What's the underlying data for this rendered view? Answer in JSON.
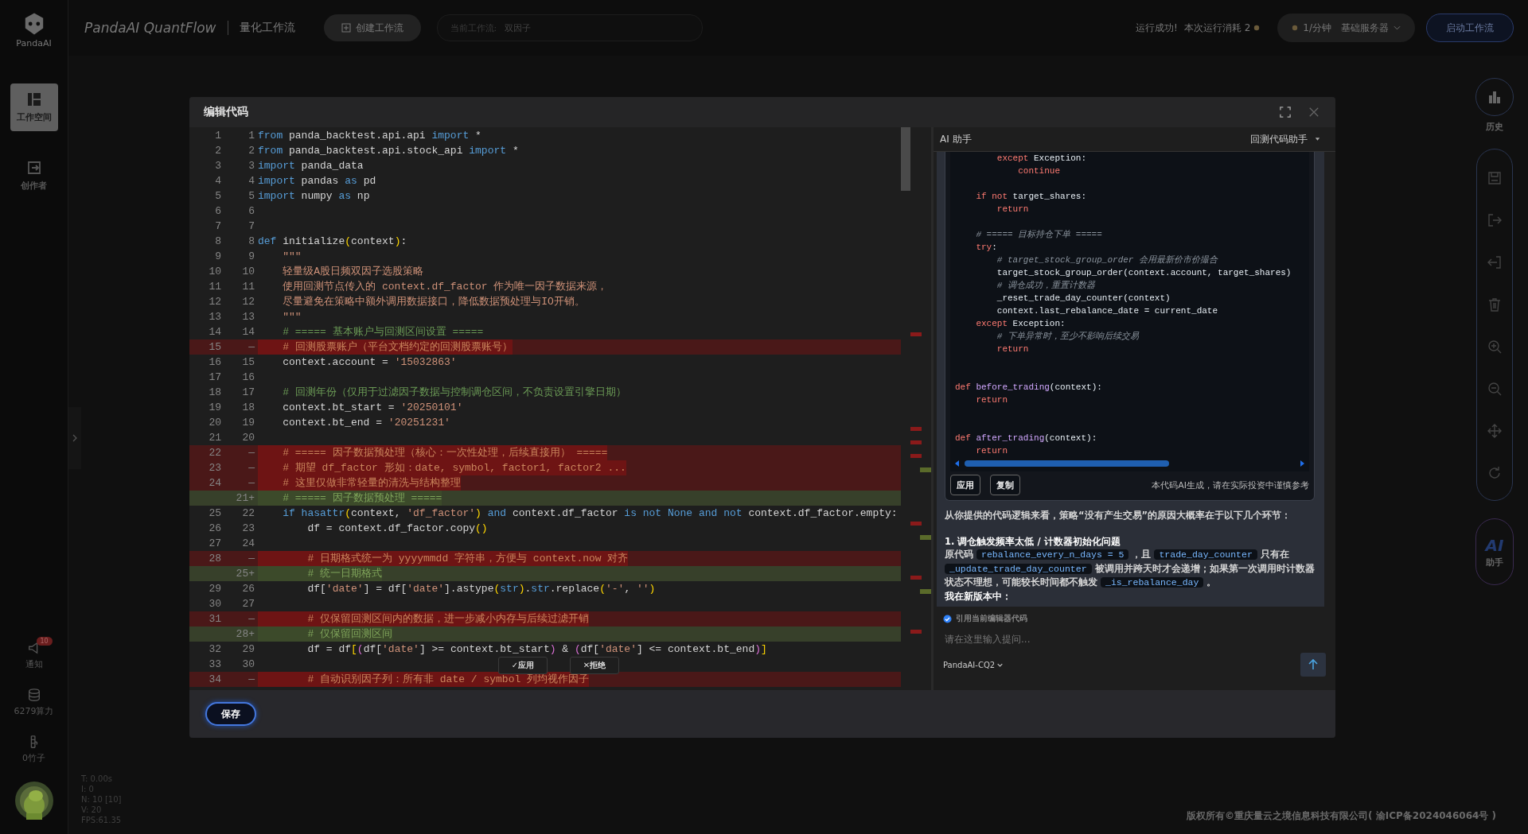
{
  "top_bar": {
    "logo_label": "PandaAI",
    "title": "PandaAI QuantFlow",
    "subtitle": "量化工作流",
    "create_button": "创建工作流",
    "workflow_field": {
      "label": "当前工作流:",
      "value": "双因子"
    },
    "run_status": "运行成功!",
    "run_cost": "本次运行消耗 2",
    "rate": "1/分钟",
    "server": "基础服务器",
    "start_button": "启动工作流"
  },
  "sidebar": {
    "items": [
      {
        "kind": "workspace",
        "label": "工作空间",
        "selected": true
      },
      {
        "kind": "creator",
        "label": "创作者",
        "selected": false
      }
    ],
    "bottom": [
      {
        "kind": "notice",
        "label": "通知",
        "badge": "10"
      },
      {
        "kind": "compute",
        "label": "6279算力"
      },
      {
        "kind": "bamboo",
        "label": "0竹子"
      }
    ]
  },
  "debug_stats": [
    "T: 0.00s",
    "I: 0",
    "N: 10 [10]",
    "V: 20",
    "FPS:61.35"
  ],
  "editor_dialog": {
    "title": "编辑代码",
    "lines": [
      {
        "old": "1",
        "new": "1",
        "kind": "context",
        "code": [
          {
            "kind": "keyword",
            "text": "from"
          },
          {
            "kind": "plain",
            "text": " panda_backtest.api.api "
          },
          {
            "kind": "keyword",
            "text": "import"
          },
          {
            "kind": "plain",
            "text": " *"
          }
        ]
      },
      {
        "old": "2",
        "new": "2",
        "kind": "context",
        "code": [
          {
            "kind": "keyword",
            "text": "from"
          },
          {
            "kind": "plain",
            "text": " panda_backtest.api.stock_api "
          },
          {
            "kind": "keyword",
            "text": "import"
          },
          {
            "kind": "plain",
            "text": " *"
          }
        ]
      },
      {
        "old": "3",
        "new": "3",
        "kind": "context",
        "code": [
          {
            "kind": "keyword",
            "text": "import"
          },
          {
            "kind": "plain",
            "text": " panda_data"
          }
        ]
      },
      {
        "old": "4",
        "new": "4",
        "kind": "context",
        "code": [
          {
            "kind": "keyword",
            "text": "import"
          },
          {
            "kind": "plain",
            "text": " pandas "
          },
          {
            "kind": "keyword",
            "text": "as"
          },
          {
            "kind": "plain",
            "text": " pd"
          }
        ]
      },
      {
        "old": "5",
        "new": "5",
        "kind": "context",
        "code": [
          {
            "kind": "keyword",
            "text": "import"
          },
          {
            "kind": "plain",
            "text": " numpy "
          },
          {
            "kind": "keyword",
            "text": "as"
          },
          {
            "kind": "plain",
            "text": " np"
          }
        ]
      },
      {
        "old": "6",
        "new": "6",
        "kind": "context"
      },
      {
        "old": "7",
        "new": "7",
        "kind": "context"
      },
      {
        "old": "8",
        "new": "8",
        "kind": "context",
        "code": [
          {
            "kind": "keyword",
            "text": "def"
          },
          {
            "kind": "plain",
            "text": " initialize"
          },
          {
            "kind": "bracket",
            "text": "("
          },
          {
            "kind": "plain",
            "text": "context"
          },
          {
            "kind": "bracket",
            "text": ")"
          },
          {
            "kind": "plain",
            "text": ":"
          }
        ]
      },
      {
        "old": "9",
        "new": "9",
        "kind": "context",
        "code": [
          {
            "kind": "doc",
            "text": "    \"\"\""
          }
        ]
      },
      {
        "old": "10",
        "new": "10",
        "kind": "context",
        "code": [
          {
            "kind": "doc",
            "text": "    轻量级A股日频双因子选股策略"
          }
        ]
      },
      {
        "old": "11",
        "new": "11",
        "kind": "context",
        "code": [
          {
            "kind": "doc",
            "text": "    使用回测节点传入的 context.df_factor 作为唯一因子数据来源，"
          }
        ]
      },
      {
        "old": "12",
        "new": "12",
        "kind": "context",
        "code": [
          {
            "kind": "doc",
            "text": "    尽量避免在策略中额外调用数据接口，降低数据预处理与IO开销。"
          }
        ]
      },
      {
        "old": "13",
        "new": "13",
        "kind": "context",
        "code": [
          {
            "kind": "doc",
            "text": "    \"\"\""
          }
        ]
      },
      {
        "old": "14",
        "new": "14",
        "kind": "context",
        "code": [
          {
            "kind": "comment",
            "text": "    # ===== 基本账户与回测区间设置 ====="
          }
        ]
      },
      {
        "old": "15",
        "new": "—",
        "kind": "removed",
        "code": [
          {
            "kind": "comment",
            "text": "    # 回测股票账户（平台文档约定的回测股票账号）"
          }
        ]
      },
      {
        "old": "16",
        "new": "15",
        "kind": "context",
        "code": [
          {
            "kind": "plain",
            "text": "    context.account = "
          },
          {
            "kind": "string",
            "text": "'15032863'"
          }
        ]
      },
      {
        "old": "17",
        "new": "16",
        "kind": "context"
      },
      {
        "old": "18",
        "new": "17",
        "kind": "context",
        "code": [
          {
            "kind": "comment",
            "text": "    # 回测年份（仅用于过滤因子数据与控制调仓区间，不负责设置引擎日期）"
          }
        ]
      },
      {
        "old": "19",
        "new": "18",
        "kind": "context",
        "code": [
          {
            "kind": "plain",
            "text": "    context.bt_start = "
          },
          {
            "kind": "string",
            "text": "'20250101'"
          }
        ]
      },
      {
        "old": "20",
        "new": "19",
        "kind": "context",
        "code": [
          {
            "kind": "plain",
            "text": "    context.bt_end = "
          },
          {
            "kind": "string",
            "text": "'20251231'"
          }
        ]
      },
      {
        "old": "21",
        "new": "20",
        "kind": "context"
      },
      {
        "old": "22",
        "new": "—",
        "kind": "removed",
        "code": [
          {
            "kind": "comment",
            "text": "    # ===== 因子数据预处理（核心：一次性处理，后续直接用） ====="
          }
        ]
      },
      {
        "old": "23",
        "new": "—",
        "kind": "removed",
        "code": [
          {
            "kind": "comment",
            "text": "    # 期望 df_factor 形如：date, symbol, factor1, factor2 ..."
          }
        ]
      },
      {
        "old": "24",
        "new": "—",
        "kind": "removed",
        "code": [
          {
            "kind": "comment",
            "text": "    # 这里仅做非常轻量的清洗与结构整理"
          }
        ]
      },
      {
        "new": "21+",
        "kind": "added",
        "code": [
          {
            "kind": "comment",
            "text": "    # ===== 因子数据预处理 ====="
          }
        ]
      },
      {
        "old": "25",
        "new": "22",
        "kind": "context",
        "code": [
          {
            "kind": "keyword",
            "text": "    if hasattr"
          },
          {
            "kind": "bracket",
            "text": "("
          },
          {
            "kind": "plain",
            "text": "context, "
          },
          {
            "kind": "string",
            "text": "'df_factor'"
          },
          {
            "kind": "bracket",
            "text": ")"
          },
          {
            "kind": "keyword",
            "text": " and"
          },
          {
            "kind": "plain",
            "text": " context.df_factor "
          },
          {
            "kind": "keyword",
            "text": "is not None and not"
          },
          {
            "kind": "plain",
            "text": " context.df_factor.empty:"
          }
        ]
      },
      {
        "old": "26",
        "new": "23",
        "kind": "context",
        "code": [
          {
            "kind": "plain",
            "text": "        df = context.df_factor.copy"
          },
          {
            "kind": "bracket",
            "text": "()"
          }
        ]
      },
      {
        "old": "27",
        "new": "24",
        "kind": "context"
      },
      {
        "old": "28",
        "new": "—",
        "kind": "removed",
        "code": [
          {
            "kind": "comment",
            "text": "        # 日期格式统一为 yyyymmdd 字符串，方便与 context.now 对齐"
          }
        ]
      },
      {
        "new": "25+",
        "kind": "added",
        "code": [
          {
            "kind": "comment",
            "text": "        # 统一日期格式"
          }
        ]
      },
      {
        "old": "29",
        "new": "26",
        "kind": "context",
        "code": [
          {
            "kind": "plain",
            "text": "        df["
          },
          {
            "kind": "string",
            "text": "'date'"
          },
          {
            "kind": "plain",
            "text": "] = df["
          },
          {
            "kind": "string",
            "text": "'date'"
          },
          {
            "kind": "plain",
            "text": "].astype"
          },
          {
            "kind": "bracket",
            "text": "("
          },
          {
            "kind": "keyword",
            "text": "str"
          },
          {
            "kind": "bracket",
            "text": ")"
          },
          {
            "kind": "plain",
            "text": "."
          },
          {
            "kind": "keyword",
            "text": "str"
          },
          {
            "kind": "plain",
            "text": ".replace"
          },
          {
            "kind": "bracket",
            "text": "("
          },
          {
            "kind": "string",
            "text": "'-'"
          },
          {
            "kind": "plain",
            "text": ", "
          },
          {
            "kind": "string",
            "text": "''"
          },
          {
            "kind": "bracket",
            "text": ")"
          }
        ]
      },
      {
        "old": "30",
        "new": "27",
        "kind": "context"
      },
      {
        "old": "31",
        "new": "—",
        "kind": "removed",
        "code": [
          {
            "kind": "comment",
            "text": "        # 仅保留回测区间内的数据，进一步减小内存与后续过滤开销"
          }
        ]
      },
      {
        "new": "28+",
        "kind": "added",
        "code": [
          {
            "kind": "comment",
            "text": "        # 仅保留回测区间"
          }
        ]
      },
      {
        "old": "32",
        "new": "29",
        "kind": "context",
        "code": [
          {
            "kind": "plain",
            "text": "        df = df"
          },
          {
            "kind": "bracket",
            "text": "["
          },
          {
            "kind": "nested",
            "text": "("
          },
          {
            "kind": "plain",
            "text": "df["
          },
          {
            "kind": "string",
            "text": "'date'"
          },
          {
            "kind": "plain",
            "text": "] >= context.bt_start"
          },
          {
            "kind": "nested",
            "text": ")"
          },
          {
            "kind": "plain",
            "text": " & "
          },
          {
            "kind": "nested",
            "text": "("
          },
          {
            "kind": "plain",
            "text": "df["
          },
          {
            "kind": "string",
            "text": "'date'"
          },
          {
            "kind": "plain",
            "text": "] <= context.bt_end"
          },
          {
            "kind": "nested",
            "text": ")"
          },
          {
            "kind": "bracket",
            "text": "]"
          }
        ]
      },
      {
        "old": "33",
        "new": "30",
        "kind": "context"
      },
      {
        "old": "34",
        "new": "—",
        "kind": "removed",
        "code": [
          {
            "kind": "comment",
            "text": "        # 自动识别因子列：所有非 date / symbol 列均视作因子"
          }
        ]
      }
    ],
    "inline_actions": [
      "✓应用",
      "✕拒绝"
    ],
    "save_button": "保存"
  },
  "ai_panel": {
    "title": "AI 助手",
    "mode": "回测代码助手",
    "code_lines": [
      {
        "kind": "code",
        "code": [
          {
            "kind": "keyword",
            "text": "        except"
          },
          {
            "kind": "plain",
            "text": " Exception:"
          }
        ]
      },
      {
        "kind": "code",
        "code": [
          {
            "kind": "keyword",
            "text": "            continue"
          }
        ]
      },
      {
        "kind": "blank"
      },
      {
        "kind": "code",
        "code": [
          {
            "kind": "keyword",
            "text": "    if not"
          },
          {
            "kind": "plain",
            "text": " target_shares:"
          }
        ]
      },
      {
        "kind": "code",
        "code": [
          {
            "kind": "keyword",
            "text": "        return"
          }
        ]
      },
      {
        "kind": "blank"
      },
      {
        "kind": "code",
        "code": [
          {
            "kind": "comment",
            "text": "    # ===== 目标持仓下单 ====="
          }
        ]
      },
      {
        "kind": "code",
        "code": [
          {
            "kind": "keyword",
            "text": "    try"
          },
          {
            "kind": "plain",
            "text": ":"
          }
        ]
      },
      {
        "kind": "code",
        "code": [
          {
            "kind": "comment",
            "text": "        # target_stock_group_order 会用最新价市价撮合"
          }
        ]
      },
      {
        "kind": "code",
        "code": [
          {
            "kind": "plain",
            "text": "        target_stock_group_order(context.account, target_shares)"
          }
        ]
      },
      {
        "kind": "code",
        "code": [
          {
            "kind": "comment",
            "text": "        # 调仓成功，重置计数器"
          }
        ]
      },
      {
        "kind": "code",
        "code": [
          {
            "kind": "plain",
            "text": "        _reset_trade_day_counter(context)"
          }
        ]
      },
      {
        "kind": "code",
        "code": [
          {
            "kind": "plain",
            "text": "        context.last_rebalance_date = current_date"
          }
        ]
      },
      {
        "kind": "code",
        "code": [
          {
            "kind": "keyword",
            "text": "    except"
          },
          {
            "kind": "plain",
            "text": " Exception:"
          }
        ]
      },
      {
        "kind": "code",
        "code": [
          {
            "kind": "comment",
            "text": "        # 下单异常时，至少不影响后续交易"
          }
        ]
      },
      {
        "kind": "code",
        "code": [
          {
            "kind": "keyword",
            "text": "        return"
          }
        ]
      },
      {
        "kind": "blank"
      },
      {
        "kind": "blank"
      },
      {
        "kind": "code",
        "code": [
          {
            "kind": "keyword",
            "text": "def"
          },
          {
            "kind": "function",
            "text": " before_trading"
          },
          {
            "kind": "plain",
            "text": "(context):"
          }
        ]
      },
      {
        "kind": "code",
        "code": [
          {
            "kind": "keyword",
            "text": "    return"
          }
        ]
      },
      {
        "kind": "blank"
      },
      {
        "kind": "blank"
      },
      {
        "kind": "code",
        "code": [
          {
            "kind": "keyword",
            "text": "def"
          },
          {
            "kind": "function",
            "text": " after_trading"
          },
          {
            "kind": "plain",
            "text": "(context):"
          }
        ]
      },
      {
        "kind": "code",
        "code": [
          {
            "kind": "keyword",
            "text": "    return"
          }
        ]
      }
    ],
    "code_actions": [
      "应用",
      "复制"
    ],
    "code_note": "本代码AI生成，请在实际投资中谨慎参考",
    "messages": [
      {
        "kind": "paragraph",
        "parts": [
          {
            "kind": "text",
            "text": "从你提供的代码逻辑来看，策略“没有产生交易”的原因大概率在于以下几个环节："
          }
        ]
      },
      {
        "kind": "heading",
        "parts": [
          {
            "kind": "text",
            "text": "1. 调仓触发频率太低 / 计数器初始化问题"
          }
        ]
      },
      {
        "kind": "paragraph",
        "parts": [
          {
            "kind": "text",
            "text": "原代码 "
          },
          {
            "kind": "code",
            "text": "rebalance_every_n_days = 5"
          },
          {
            "kind": "text",
            "text": " ，且 "
          },
          {
            "kind": "code",
            "text": "trade_day_counter"
          },
          {
            "kind": "text",
            "text": " 只有在 "
          },
          {
            "kind": "code",
            "text": "_update_trade_day_counter"
          },
          {
            "kind": "text",
            "text": " 被调用并跨天时才会递增；如果第一次调用时计数器状态不理想，可能较长时间都不触发 "
          },
          {
            "kind": "code",
            "text": "_is_rebalance_day"
          },
          {
            "kind": "text",
            "text": " 。"
          }
        ]
      },
      {
        "kind": "heading",
        "parts": [
          {
            "kind": "text",
            "text": "我在新版本中："
          }
        ]
      }
    ],
    "use_editor_code": {
      "label": "引用当前编辑器代码",
      "checked": true
    },
    "input": {
      "placeholder": "请在这里输入提问..."
    },
    "model": "PandaAI-CQ2"
  },
  "right_rail": {
    "history": "历史",
    "ai_logo": "AI",
    "ai_label": "助手"
  },
  "footer": "版权所有©重庆量云之境信息科技有限公司( 渝ICP备2024046064号 )"
}
